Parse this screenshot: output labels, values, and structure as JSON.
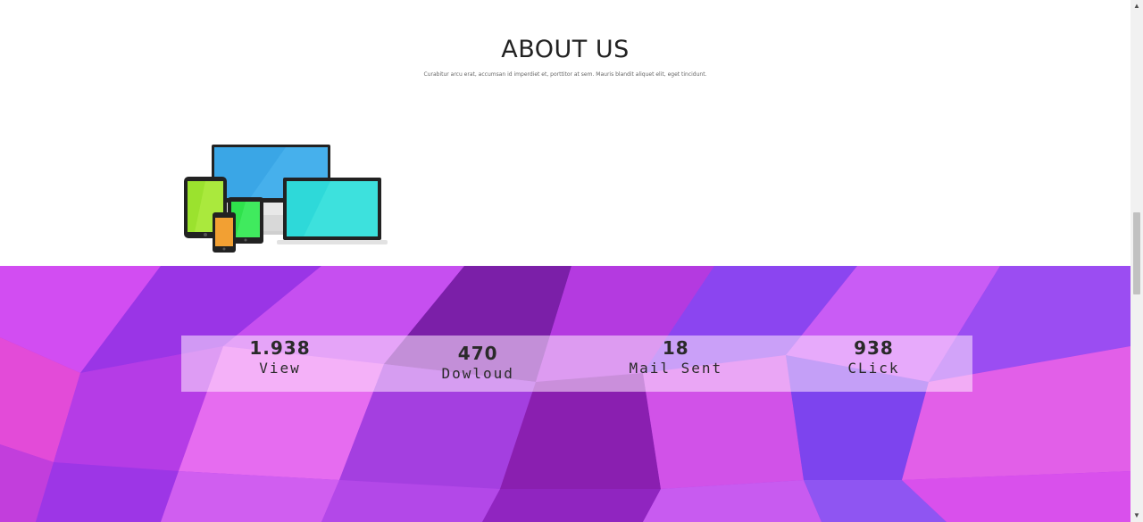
{
  "about": {
    "title": "ABOUT US",
    "subtitle": "Curabitur arcu erat, accumsan id imperdiet et, porttitor at sem. Mauris blandit aliquet elit, eget tincidunt."
  },
  "stats": [
    {
      "value": "1.938",
      "label": "View"
    },
    {
      "value": "470",
      "label": "Dowloud"
    },
    {
      "value": "18",
      "label": "Mail Sent"
    },
    {
      "value": "938",
      "label": "CLick"
    }
  ],
  "colors": {
    "accent_purple": "#b03ae8",
    "magenta": "#e23bd9",
    "violet": "#7a3df0"
  }
}
